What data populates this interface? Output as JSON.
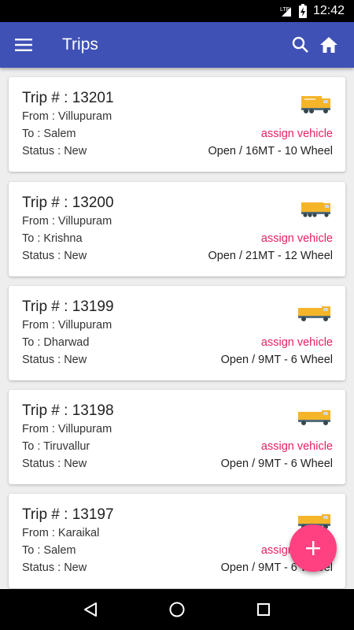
{
  "status_bar": {
    "time": "12:42",
    "network": "LTE",
    "icons": [
      "lte-icon",
      "signal-icon",
      "battery-charging-icon"
    ]
  },
  "app_bar": {
    "title": "Trips",
    "icons": [
      "menu-icon",
      "search-icon",
      "home-icon"
    ],
    "color": "#3f51b5"
  },
  "trips": [
    {
      "trip_no": "Trip # : 13201",
      "from": "From : Villupuram",
      "to": "To : Salem",
      "status": "Status : New",
      "action": "assign vehicle",
      "capacity": "Open / 16MT - 10 Wheel",
      "icon": "truck-icon"
    },
    {
      "trip_no": "Trip # : 13200",
      "from": "From : Villupuram",
      "to": "To : Krishna",
      "status": "Status : New",
      "action": "assign vehicle",
      "capacity": "Open / 21MT - 12 Wheel",
      "icon": "truck-icon"
    },
    {
      "trip_no": "Trip # : 13199",
      "from": "From : Villupuram",
      "to": "To : Dharwad",
      "status": "Status : New",
      "action": "assign vehicle",
      "capacity": "Open / 9MT - 6 Wheel",
      "icon": "truck-icon"
    },
    {
      "trip_no": "Trip # : 13198",
      "from": "From : Villupuram",
      "to": "To : Tiruvallur",
      "status": "Status : New",
      "action": "assign vehicle",
      "capacity": "Open / 9MT - 6 Wheel",
      "icon": "truck-icon"
    },
    {
      "trip_no": "Trip # : 13197",
      "from": "From : Karaikal",
      "to": "To : Salem",
      "status": "Status : New",
      "action": "assign vehicle",
      "capacity": "Open / 9MT - 6 Wheel",
      "icon": "truck-icon"
    }
  ],
  "fab": {
    "icon": "add-icon",
    "label": "+",
    "color": "#ff4081"
  },
  "nav_bar": {
    "icons": [
      "back-icon",
      "home-circle-icon",
      "recents-icon"
    ]
  },
  "colors": {
    "accent": "#e91e63",
    "background": "#eeeeee"
  }
}
